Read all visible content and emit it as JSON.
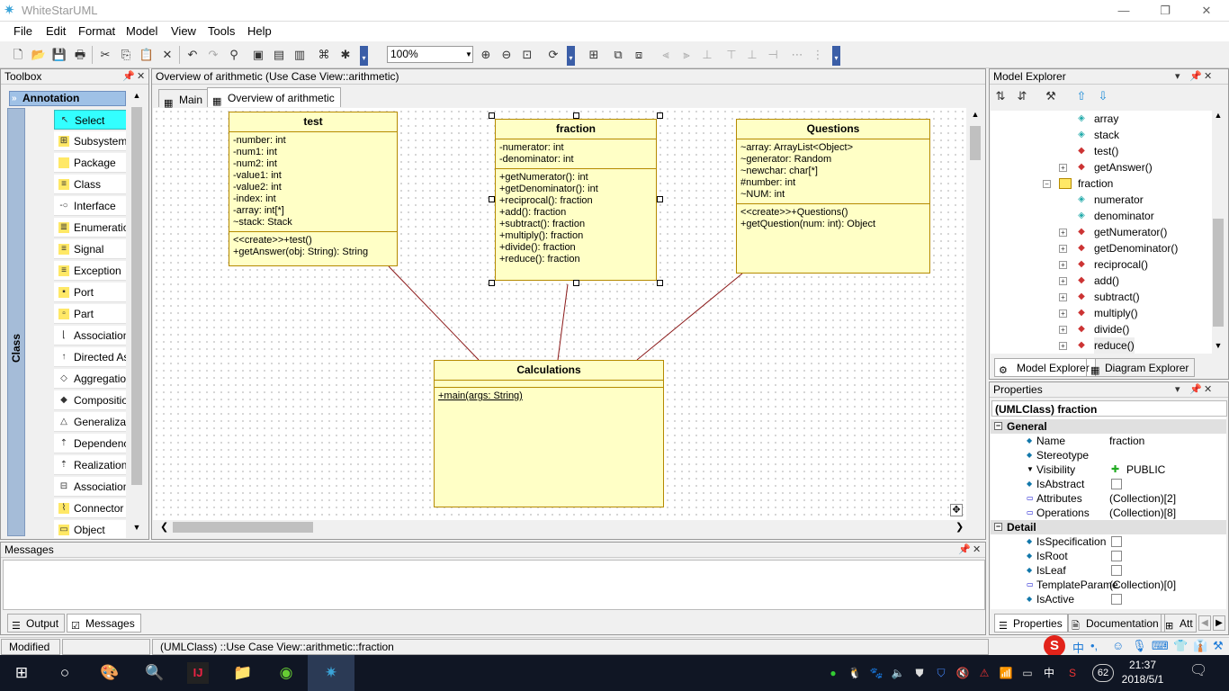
{
  "window": {
    "title": "WhiteStarUML",
    "minimize": "—",
    "restore": "❐",
    "close": "✕"
  },
  "menu": [
    "File",
    "Edit",
    "Format",
    "Model",
    "View",
    "Tools",
    "Help"
  ],
  "toolbar": {
    "zoom_value": "100%"
  },
  "toolbox": {
    "title": "Toolbox",
    "section": "Annotation",
    "sidebar_label": "Class",
    "tools": [
      "Select",
      "Subsystem",
      "Package",
      "Class",
      "Interface",
      "Enumeration",
      "Signal",
      "Exception",
      "Port",
      "Part",
      "Association",
      "Directed Associ...",
      "Aggregation",
      "Composition",
      "Generalization",
      "Dependency",
      "Realization",
      "Association Class",
      "Connector",
      "Object"
    ]
  },
  "diagram": {
    "window_title": "Overview of arithmetic (Use Case View::arithmetic)",
    "tabs": [
      "Main",
      "Overview of arithmetic"
    ],
    "classes": {
      "test": {
        "name": "test",
        "attributes": [
          "-number: int",
          "-num1: int",
          "-num2: int",
          "-value1: int",
          "-value2: int",
          "-index: int",
          "-array: int[*]",
          "~stack: Stack"
        ],
        "operations": [
          "<<create>>+test()",
          "+getAnswer(obj: String): String"
        ]
      },
      "fraction": {
        "name": "fraction",
        "attributes": [
          "-numerator: int",
          "-denominator: int"
        ],
        "operations": [
          "+getNumerator(): int",
          "+getDenominator(): int",
          "+reciprocal(): fraction",
          "+add(): fraction",
          "+subtract(): fraction",
          "+multiply(): fraction",
          "+divide(): fraction",
          "+reduce(): fraction"
        ]
      },
      "questions": {
        "name": "Questions",
        "attributes": [
          "~array: ArrayList<Object>",
          "~generator: Random",
          "~newchar: char[*]",
          "#number: int",
          "~NUM: int"
        ],
        "operations": [
          "<<create>>+Questions()",
          "+getQuestion(num: int): Object"
        ]
      },
      "calculations": {
        "name": "Calculations",
        "attributes": [],
        "operations": [
          "+main(args: String)"
        ]
      }
    }
  },
  "model_explorer": {
    "title": "Model Explorer",
    "nodes": [
      {
        "label": "array",
        "icon": "attribute-icon",
        "indent": 1,
        "expand": ""
      },
      {
        "label": "stack",
        "icon": "attribute-icon",
        "indent": 1,
        "expand": ""
      },
      {
        "label": "test()",
        "icon": "operation-icon",
        "indent": 1,
        "expand": ""
      },
      {
        "label": "getAnswer()",
        "icon": "operation-icon",
        "indent": 1,
        "expand": "+"
      },
      {
        "label": "fraction",
        "icon": "class-icon",
        "indent": 0,
        "expand": "−"
      },
      {
        "label": "numerator",
        "icon": "attribute-icon",
        "indent": 1,
        "expand": ""
      },
      {
        "label": "denominator",
        "icon": "attribute-icon",
        "indent": 1,
        "expand": ""
      },
      {
        "label": "getNumerator()",
        "icon": "operation-icon",
        "indent": 1,
        "expand": "+"
      },
      {
        "label": "getDenominator()",
        "icon": "operation-icon",
        "indent": 1,
        "expand": "+"
      },
      {
        "label": "reciprocal()",
        "icon": "operation-icon",
        "indent": 1,
        "expand": "+"
      },
      {
        "label": "add()",
        "icon": "operation-icon",
        "indent": 1,
        "expand": "+"
      },
      {
        "label": "subtract()",
        "icon": "operation-icon",
        "indent": 1,
        "expand": "+"
      },
      {
        "label": "multiply()",
        "icon": "operation-icon",
        "indent": 1,
        "expand": "+"
      },
      {
        "label": "divide()",
        "icon": "operation-icon",
        "indent": 1,
        "expand": "+"
      },
      {
        "label": "reduce()",
        "icon": "operation-icon",
        "indent": 1,
        "expand": "+"
      }
    ],
    "tabs": [
      "Model Explorer",
      "Diagram Explorer"
    ]
  },
  "properties": {
    "title": "Properties",
    "heading": "(UMLClass) fraction",
    "general_label": "General",
    "detail_label": "Detail",
    "name_key": "Name",
    "name_value": "fraction",
    "stereotype_key": "Stereotype",
    "visibility_key": "Visibility",
    "visibility_value": "PUBLIC",
    "isabstract_key": "IsAbstract",
    "attributes_key": "Attributes",
    "attributes_value": "(Collection)[2]",
    "operations_key": "Operations",
    "operations_value": "(Collection)[8]",
    "isspecification_key": "IsSpecification",
    "isroot_key": "IsRoot",
    "isleaf_key": "IsLeaf",
    "templateparams_key": "TemplateParame",
    "templateparams_value": "(Collection)[0]",
    "isactive_key": "IsActive",
    "tabs": [
      "Properties",
      "Documentation",
      "Att"
    ]
  },
  "messages": {
    "title": "Messages",
    "tabs": [
      "Output",
      "Messages"
    ]
  },
  "statusbar": {
    "state": "Modified",
    "path": "(UMLClass) ::Use Case View::arithmetic::fraction"
  },
  "taskbar": {
    "time": "21:37",
    "date": "2018/5/1",
    "ime": "中",
    "battery": "62"
  }
}
